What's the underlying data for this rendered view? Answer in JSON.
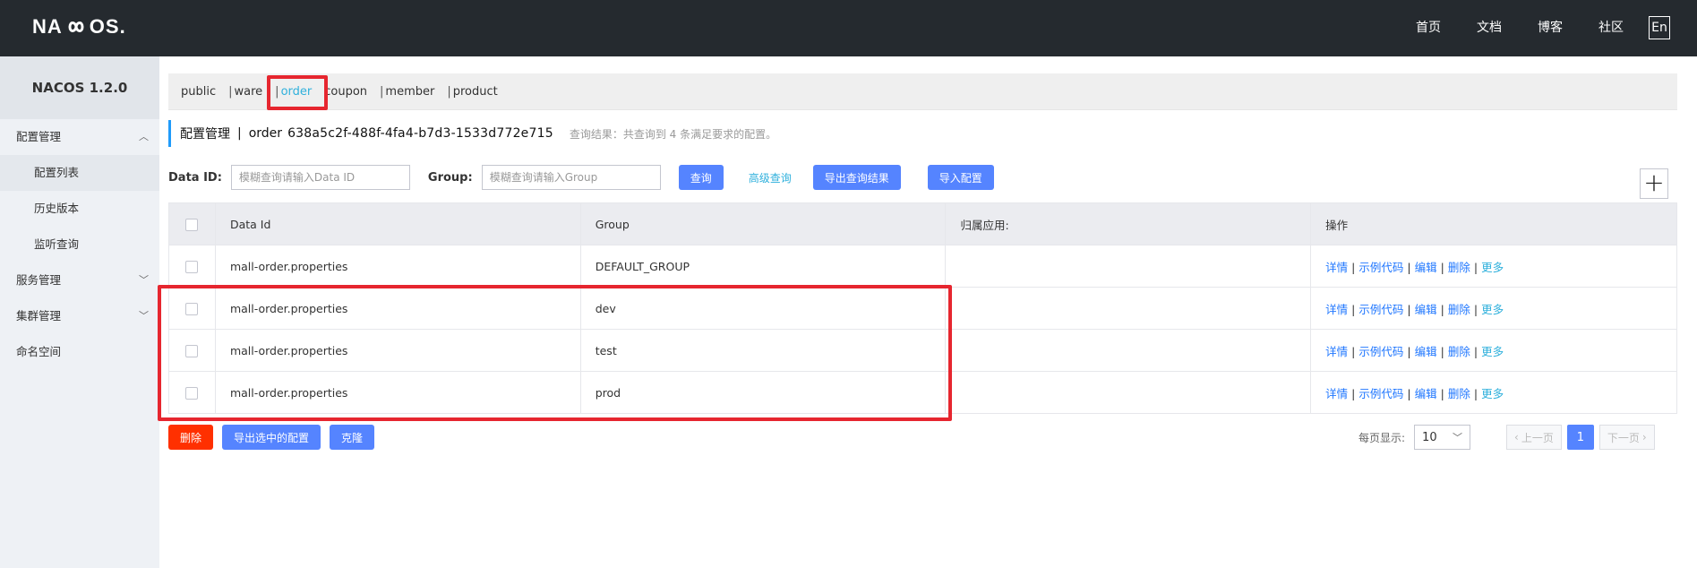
{
  "header": {
    "logo": "NACOS.",
    "nav": [
      "首页",
      "文档",
      "博客",
      "社区"
    ],
    "lang": "En"
  },
  "sidebar": {
    "title": "NACOS 1.2.0",
    "items": [
      {
        "label": "配置管理",
        "type": "group",
        "chevron": "up"
      },
      {
        "label": "配置列表",
        "type": "sub",
        "active": true
      },
      {
        "label": "历史版本",
        "type": "sub"
      },
      {
        "label": "监听查询",
        "type": "sub"
      },
      {
        "label": "服务管理",
        "type": "group",
        "chevron": "down"
      },
      {
        "label": "集群管理",
        "type": "group",
        "chevron": "down"
      },
      {
        "label": "命名空间",
        "type": "group"
      }
    ]
  },
  "namespaces": [
    "public",
    "ware",
    "order",
    "coupon",
    "member",
    "product"
  ],
  "selected_namespace": "order",
  "page": {
    "title": "配置管理",
    "separator": "|",
    "namespace": "order",
    "namespace_id": "638a5c2f-488f-4fa4-b7d3-1533d772e715",
    "query_result": "查询结果：共查询到 4 条满足要求的配置。"
  },
  "search": {
    "data_id_label": "Data ID:",
    "data_id_placeholder": "模糊查询请输入Data ID",
    "group_label": "Group:",
    "group_placeholder": "模糊查询请输入Group",
    "query_btn": "查询",
    "advanced_link": "高级查询",
    "export_result_btn": "导出查询结果",
    "import_btn": "导入配置",
    "add_btn": "+"
  },
  "table": {
    "columns": [
      "Data Id",
      "Group",
      "归属应用:",
      "操作"
    ],
    "rows": [
      {
        "data_id": "mall-order.properties",
        "group": "DEFAULT_GROUP",
        "app": ""
      },
      {
        "data_id": "mall-order.properties",
        "group": "dev",
        "app": ""
      },
      {
        "data_id": "mall-order.properties",
        "group": "test",
        "app": ""
      },
      {
        "data_id": "mall-order.properties",
        "group": "prod",
        "app": ""
      }
    ],
    "ops": [
      "详情",
      "示例代码",
      "编辑",
      "删除",
      "更多"
    ]
  },
  "bottom": {
    "delete_btn": "删除",
    "export_selected_btn": "导出选中的配置",
    "clone_btn": "克隆"
  },
  "pager": {
    "per_page_label": "每页显示:",
    "per_page": "10",
    "prev": "上一页",
    "current": "1",
    "next": "下一页"
  },
  "colors": {
    "header_bg": "#252a2f",
    "accent_blue": "#5584ff",
    "link_cyan": "#2fb0dc",
    "danger_red": "#ff3000",
    "highlight_red": "#e6262f"
  }
}
